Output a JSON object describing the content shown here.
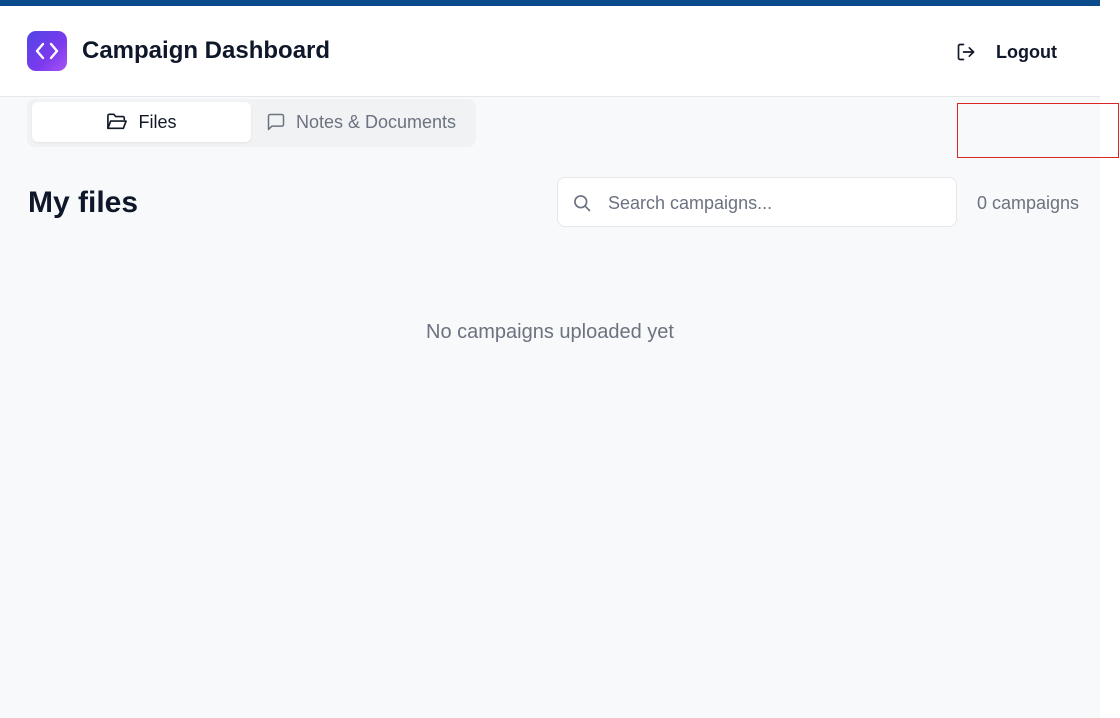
{
  "app": {
    "title": "Campaign Dashboard",
    "logo_icon": "code-brackets-icon",
    "accent_gradient": [
      "#4f46e5",
      "#a855f7"
    ],
    "top_strip_color": "#0b4a8b"
  },
  "header": {
    "logout_label": "Logout",
    "logout_icon": "logout-arrow-icon"
  },
  "tabs": [
    {
      "label": "Files",
      "icon": "folder-open-icon",
      "active": true
    },
    {
      "label": "Notes & Documents",
      "icon": "message-square-icon",
      "active": false
    }
  ],
  "main": {
    "heading": "My files",
    "search": {
      "placeholder": "Search campaigns...",
      "value": "",
      "icon": "search-icon"
    },
    "count_text": "0 campaigns",
    "empty_message": "No campaigns uploaded yet"
  },
  "colors": {
    "selection_outline": "#dc2626"
  }
}
